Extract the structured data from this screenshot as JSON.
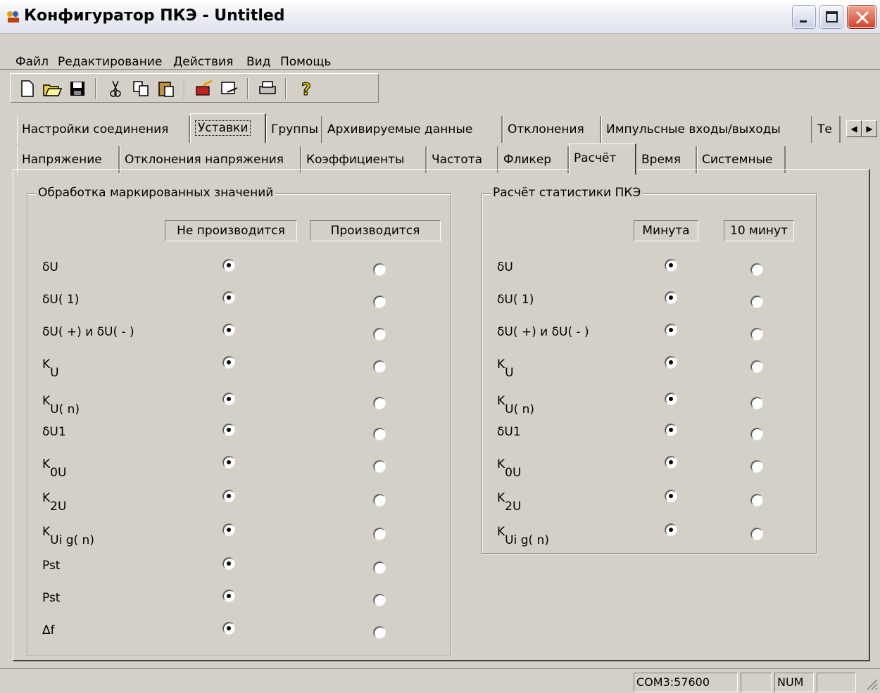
{
  "window": {
    "title": "Конфигуратор ПКЭ - Untitled"
  },
  "menu": [
    "Файл",
    "Редактирование",
    "Действия",
    "Вид",
    "Помощь"
  ],
  "toolbar": {
    "icons": [
      "new-icon",
      "open-icon",
      "save-icon",
      "cut-icon",
      "copy-icon",
      "paste-icon",
      "read-device-icon",
      "write-device-icon",
      "print-icon",
      "help-icon"
    ]
  },
  "tabs_main": [
    "Настройки соединения",
    "Уставки",
    "Группы",
    "Архивируемые данные",
    "Отклонения",
    "Импульсные входы/выходы",
    "Те"
  ],
  "tabs_sub": [
    "Напряжение",
    "Отклонения напряжения",
    "Коэффициенты",
    "Частота",
    "Фликер",
    "Расчёт",
    "Время",
    "Системные"
  ],
  "left_group": {
    "title": "Обработка маркированных значений",
    "col1": "Не производится",
    "col2": "Производится"
  },
  "right_group": {
    "title": "Расчёт статистики ПКЭ",
    "col1": "Минута",
    "col2": "10 минут"
  },
  "rows_left": [
    {
      "base": "δU",
      "sub": "",
      "selected": 1
    },
    {
      "base": "δU( 1)",
      "sub": "",
      "selected": 1
    },
    {
      "base": "δU( +)  и  δU( - )",
      "sub": "",
      "selected": 1
    },
    {
      "base": "K",
      "sub": "U",
      "selected": 1
    },
    {
      "base": "K",
      "sub": "U( n)",
      "selected": 1
    },
    {
      "base": "δU1",
      "sub": "",
      "selected": 1
    },
    {
      "base": "K",
      "sub": "0U",
      "selected": 1
    },
    {
      "base": "K",
      "sub": "2U",
      "selected": 1
    },
    {
      "base": "K",
      "sub": "Ui g( n)",
      "selected": 1
    },
    {
      "base": "Pst",
      "sub": "",
      "selected": 1
    },
    {
      "base": "Pst",
      "sub": "",
      "selected": 1
    },
    {
      "base": "Δf",
      "sub": "",
      "selected": 1
    }
  ],
  "rows_right": [
    {
      "base": "δU",
      "sub": "",
      "selected": 1
    },
    {
      "base": "δU( 1)",
      "sub": "",
      "selected": 1
    },
    {
      "base": "δU( +)  и  δU( - )",
      "sub": "",
      "selected": 1
    },
    {
      "base": "K",
      "sub": "U",
      "selected": 1
    },
    {
      "base": "K",
      "sub": "U( n)",
      "selected": 1
    },
    {
      "base": "δU1",
      "sub": "",
      "selected": 1
    },
    {
      "base": "K",
      "sub": "0U",
      "selected": 1
    },
    {
      "base": "K",
      "sub": "2U",
      "selected": 1
    },
    {
      "base": "K",
      "sub": "Ui g( n)",
      "selected": 1
    }
  ],
  "status": {
    "port": "COM3:57600",
    "num": "NUM"
  }
}
